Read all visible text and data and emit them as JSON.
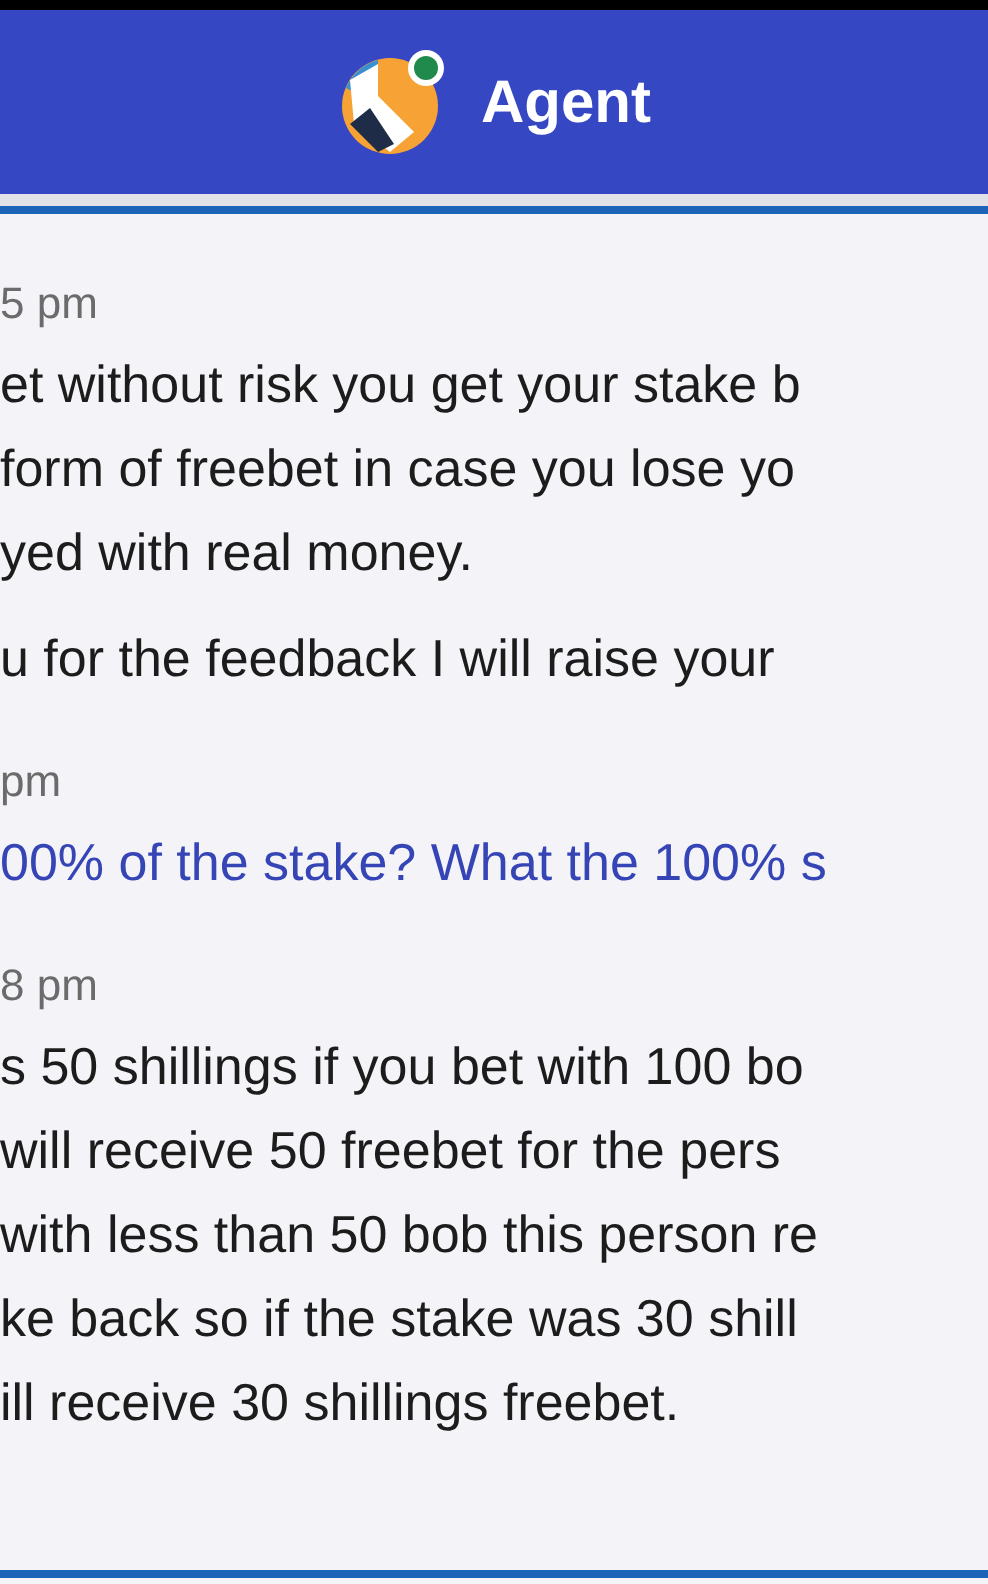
{
  "header": {
    "title": "Agent",
    "online": true
  },
  "messages": [
    {
      "kind": "agent",
      "time": "5 pm",
      "paragraphs": [
        [
          "et without risk you get your stake b",
          "form of freebet in case you lose yo",
          "yed with real money."
        ],
        [
          "u for the feedback I will raise your"
        ]
      ]
    },
    {
      "kind": "customer",
      "time": "pm",
      "paragraphs": [
        [
          "00% of the stake? What the 100% s"
        ]
      ]
    },
    {
      "kind": "agent",
      "time": "8 pm",
      "paragraphs": [
        [
          "s 50 shillings if you bet with 100 bo",
          "will receive 50 freebet for the pers",
          "with less than 50 bob this person re",
          "ke back so if the stake was 30 shill",
          "ill receive 30 shillings freebet."
        ]
      ]
    }
  ]
}
